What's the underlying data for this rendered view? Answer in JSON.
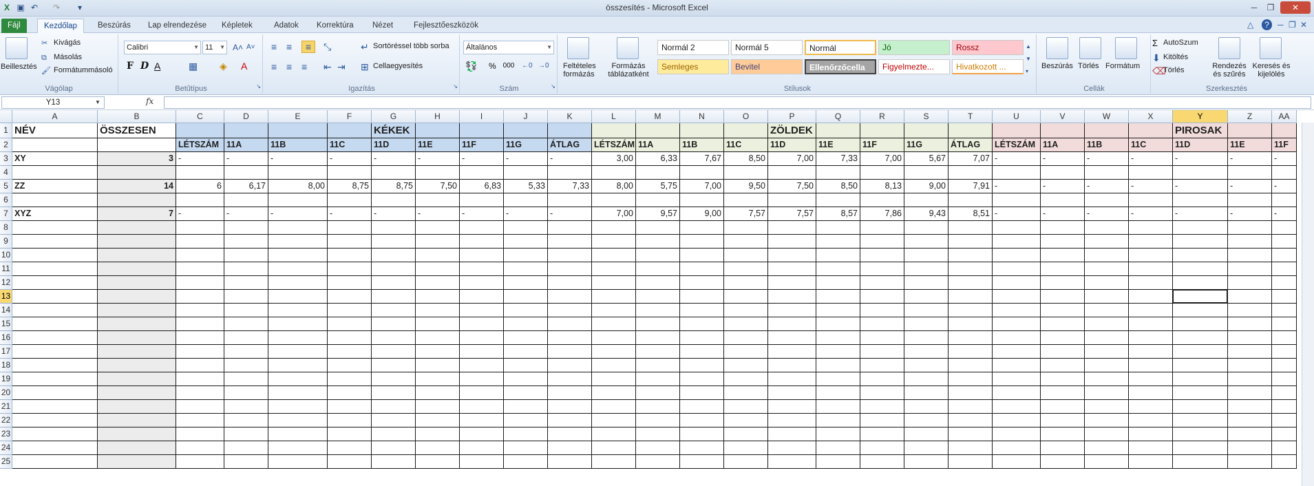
{
  "window": {
    "title": "összesítés - Microsoft Excel"
  },
  "tabs": [
    "Fájl",
    "Kezdőlap",
    "Beszúrás",
    "Lap elrendezése",
    "Képletek",
    "Adatok",
    "Korrektúra",
    "Nézet",
    "Fejlesztőeszközök"
  ],
  "ribbon": {
    "clipboard": {
      "paste": "Beillesztés",
      "cut": "Kivágás",
      "copy": "Másolás",
      "format_painter": "Formátummásoló",
      "label": "Vágólap"
    },
    "font": {
      "name": "Calibri",
      "size": "11",
      "bold": "F",
      "italic": "D",
      "underline": "A",
      "label": "Betűtípus"
    },
    "alignment": {
      "wrap": "Sortöréssel több sorba",
      "merge": "Cellaegyesítés",
      "label": "Igazítás"
    },
    "number": {
      "format": "Általános",
      "label": "Szám",
      "percent": "%",
      "thousands": "000"
    },
    "styles": {
      "conditional": "Feltételes formázás",
      "as_table": "Formázás táblázatként",
      "items": [
        "Normál 2",
        "Normál 5",
        "Normál",
        "Jó",
        "Rossz",
        "Semleges",
        "Bevitel",
        "Ellenőrzőcella",
        "Figyelmezte...",
        "Hivatkozott ..."
      ],
      "label": "Stílusok"
    },
    "cells": {
      "insert": "Beszúrás",
      "delete": "Törlés",
      "format": "Formátum",
      "label": "Cellák"
    },
    "editing": {
      "autosum": "AutoSzum",
      "fill": "Kitöltés",
      "clear": "Törlés",
      "sort": "Rendezés és szűrés",
      "find": "Keresés és kijelölés",
      "label": "Szerkesztés"
    }
  },
  "formula_bar": {
    "name_box": "Y13",
    "fx": "fx",
    "value": ""
  },
  "columns": [
    "A",
    "B",
    "C",
    "D",
    "E",
    "F",
    "G",
    "H",
    "I",
    "J",
    "K",
    "L",
    "M",
    "N",
    "O",
    "P",
    "Q",
    "R",
    "S",
    "T",
    "U",
    "V",
    "W",
    "X",
    "Y",
    "Z",
    "AA"
  ],
  "rows": [
    "1",
    "2",
    "3",
    "4",
    "5",
    "6",
    "7",
    "8",
    "9",
    "10",
    "11",
    "12",
    "13",
    "14",
    "15",
    "16",
    "17",
    "18",
    "19",
    "20",
    "21",
    "22",
    "23",
    "24",
    "25"
  ],
  "selected": {
    "cell": "Y13",
    "column": "Y",
    "row": "13"
  },
  "sheet": {
    "A1": "NÉV",
    "B1": "ÖSSZESEN",
    "G1": "KÉKEK",
    "P1": "ZÖLDEK",
    "Y1": "PIROSAK",
    "row2": [
      "LÉTSZÁM",
      "11A",
      "11B",
      "11C",
      "11D",
      "11E",
      "11F",
      "11G",
      "ÁTLAG",
      "LÉTSZÁM",
      "11A",
      "11B",
      "11C",
      "11D",
      "11E",
      "11F",
      "11G",
      "ÁTLAG",
      "LÉTSZÁM",
      "11A",
      "11B",
      "11C",
      "11D",
      "11E",
      "11F"
    ],
    "data": [
      {
        "row": 3,
        "name": "XY",
        "total": "3",
        "values": [
          "-",
          "-",
          "-",
          "-",
          "-",
          "-",
          "-",
          "-",
          "-",
          "3,00",
          "6,33",
          "7,67",
          "8,50",
          "7,00",
          "7,33",
          "7,00",
          "5,67",
          "7,07",
          "-",
          "-",
          "-",
          "-",
          "-",
          "-",
          "-"
        ]
      },
      {
        "row": 5,
        "name": "ZZ",
        "total": "14",
        "values": [
          "6",
          "6,17",
          "8,00",
          "8,75",
          "8,75",
          "7,50",
          "6,83",
          "5,33",
          "7,33",
          "8,00",
          "5,75",
          "7,00",
          "9,50",
          "7,50",
          "8,50",
          "8,13",
          "9,00",
          "7,91",
          "-",
          "-",
          "-",
          "-",
          "-",
          "-",
          "-"
        ]
      },
      {
        "row": 7,
        "name": "XYZ",
        "total": "7",
        "values": [
          "-",
          "-",
          "-",
          "-",
          "-",
          "-",
          "-",
          "-",
          "-",
          "7,00",
          "9,57",
          "9,00",
          "7,57",
          "7,57",
          "8,57",
          "7,86",
          "9,43",
          "8,51",
          "-",
          "-",
          "-",
          "-",
          "-",
          "-",
          "-"
        ]
      }
    ]
  },
  "colors": {
    "blue": "#c5d9f1",
    "green": "#ebf1de",
    "red": "#f2dcdb",
    "gray": "#ececec"
  }
}
